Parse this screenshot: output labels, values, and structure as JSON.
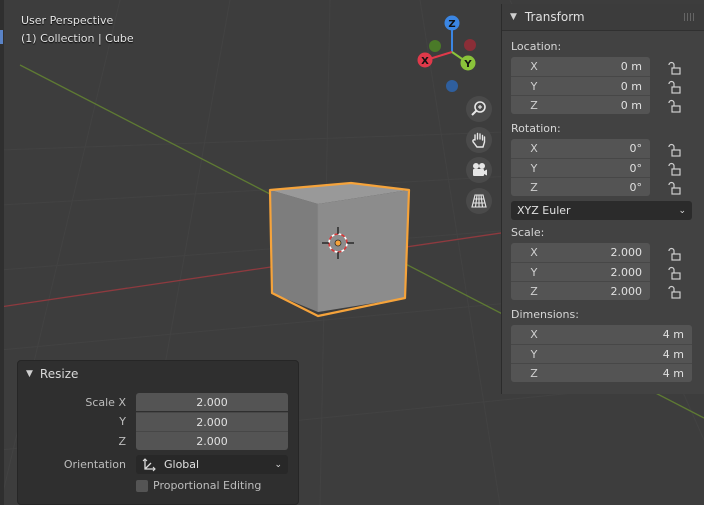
{
  "viewport": {
    "title": "User Perspective",
    "collection": "(1) Collection | Cube",
    "gizmo": {
      "x": "X",
      "y": "Y",
      "z": "Z"
    },
    "nav_icons": [
      "zoom-icon",
      "hand-icon",
      "camera-icon",
      "grid-icon"
    ]
  },
  "transform": {
    "title": "Transform",
    "location": {
      "label": "Location:",
      "x": "0 m",
      "y": "0 m",
      "z": "0 m"
    },
    "rotation": {
      "label": "Rotation:",
      "x": "0°",
      "y": "0°",
      "z": "0°",
      "mode": "XYZ Euler"
    },
    "scale": {
      "label": "Scale:",
      "x": "2.000",
      "y": "2.000",
      "z": "2.000"
    },
    "dimensions": {
      "label": "Dimensions:",
      "x": "4 m",
      "y": "4 m",
      "z": "4 m"
    },
    "axes": {
      "x": "X",
      "y": "Y",
      "z": "Z"
    }
  },
  "resize": {
    "title": "Resize",
    "scale_x_label": "Scale X",
    "y_label": "Y",
    "z_label": "Z",
    "scale_x": "2.000",
    "scale_y": "2.000",
    "scale_z": "2.000",
    "orientation_label": "Orientation",
    "orientation_value": "Global",
    "proportional_label": "Proportional Editing",
    "proportional_checked": false
  },
  "colors": {
    "selection_outline": "#f5a33b",
    "axis_x": "#e0394a",
    "axis_y": "#8ac33a",
    "axis_z": "#3b86e3"
  }
}
